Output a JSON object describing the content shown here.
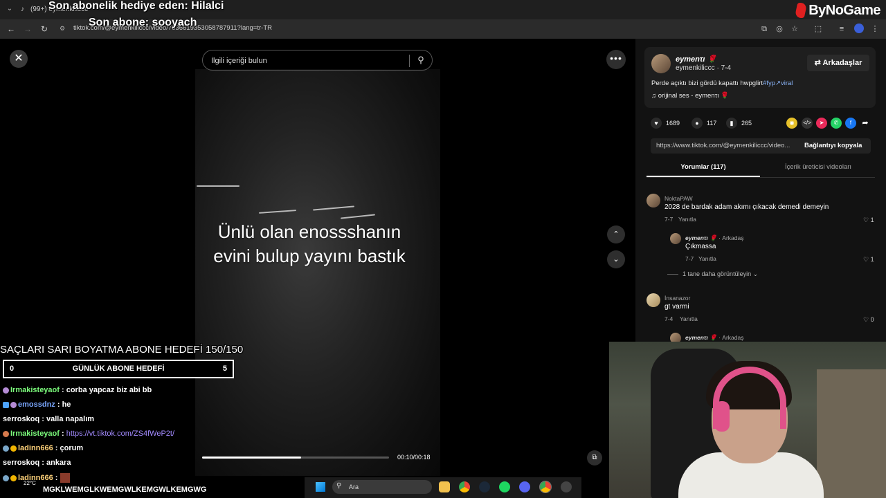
{
  "browser": {
    "tab_title": "(99+) eymenkiliccc",
    "url": "tiktok.com/@eymenkiliccc/video/7636619353058787911?lang=tr-TR"
  },
  "stream_overlay": {
    "last_gift_sub": "Son abonelik hediye eden: Hilalci",
    "last_sub": "Son abone: sooyach",
    "brand": "ByNoGame",
    "goal_title": "SAÇLARI SARI BOYATMA ABONE HEDEFİ 150/150",
    "daily_goal_current": "0",
    "daily_goal_label": "GÜNLÜK ABONE HEDEFİ",
    "daily_goal_target": "5",
    "chat": [
      {
        "user": "Irmakisteyaof",
        "msg": " : corba yapcaz biz abi bb"
      },
      {
        "user": "emossdnz",
        "msg": " : he"
      },
      {
        "user": "serroskoq",
        "msg": " : valla napalım"
      },
      {
        "user": "Irmakisteyaof",
        "msg": " : ",
        "link": "https://vt.tiktok.com/ZS4fWeP2t/"
      },
      {
        "user": "ladinn666",
        "msg": " : çorum"
      },
      {
        "user": "serroskoq",
        "msg": " : ankara"
      },
      {
        "user": "ladinn666",
        "msg": " : "
      }
    ],
    "bottom_chat": "MGKLWEMGLKWEMGWLKEMGWLKEMGWG",
    "weather": "22°C"
  },
  "video": {
    "search_placeholder": "İlgili içeriği bulun",
    "caption": "Ünlü olan enossshanın evini bulup yayını bastık",
    "time": "00:10/00:18",
    "progress": 0.53
  },
  "panel": {
    "author_name": "eymenτι 🌹",
    "author_meta": "eymenkiliccc · 7-4",
    "friends_label": "⇄ Arkadaşlar",
    "description": "Perde açıktı bizi gördü kapattı hwpglirt",
    "hashtags": "#fyp↗viral",
    "sound": "♫  orijinal ses - eymenτι 🌹",
    "likes": "1689",
    "comments_count": "117",
    "saves": "265",
    "link": "https://www.tiktok.com/@eymenkiliccc/video...",
    "copy_label": "Bağlantıyı kopyala",
    "tab_comments": "Yorumlar (117)",
    "tab_creator": "İçerik üreticisi videoları",
    "comments": [
      {
        "name": "NoktaPAW",
        "text": "2028 de bardak adam akımı çıkacak demedi demeyin",
        "date": "7-7",
        "reply": "Yanıtla",
        "likes": "♡ 1"
      },
      {
        "name": "eymenτι 🌹",
        "badge": " · Arkadaş",
        "text": "Çıkmassa",
        "date": "7-7",
        "reply": "Yanıtla",
        "likes": "♡ 1"
      },
      {
        "name": "İnsanazor",
        "text": "gt varmi",
        "date": "7-4",
        "reply": "Yanıtla",
        "likes": "♡ 0"
      },
      {
        "name": "eymenτι 🌹",
        "badge": " · Arkadaş"
      }
    ],
    "view_more": "1 tane daha görüntüleyin ⌄"
  },
  "taskbar": {
    "search_label": "Ara"
  }
}
